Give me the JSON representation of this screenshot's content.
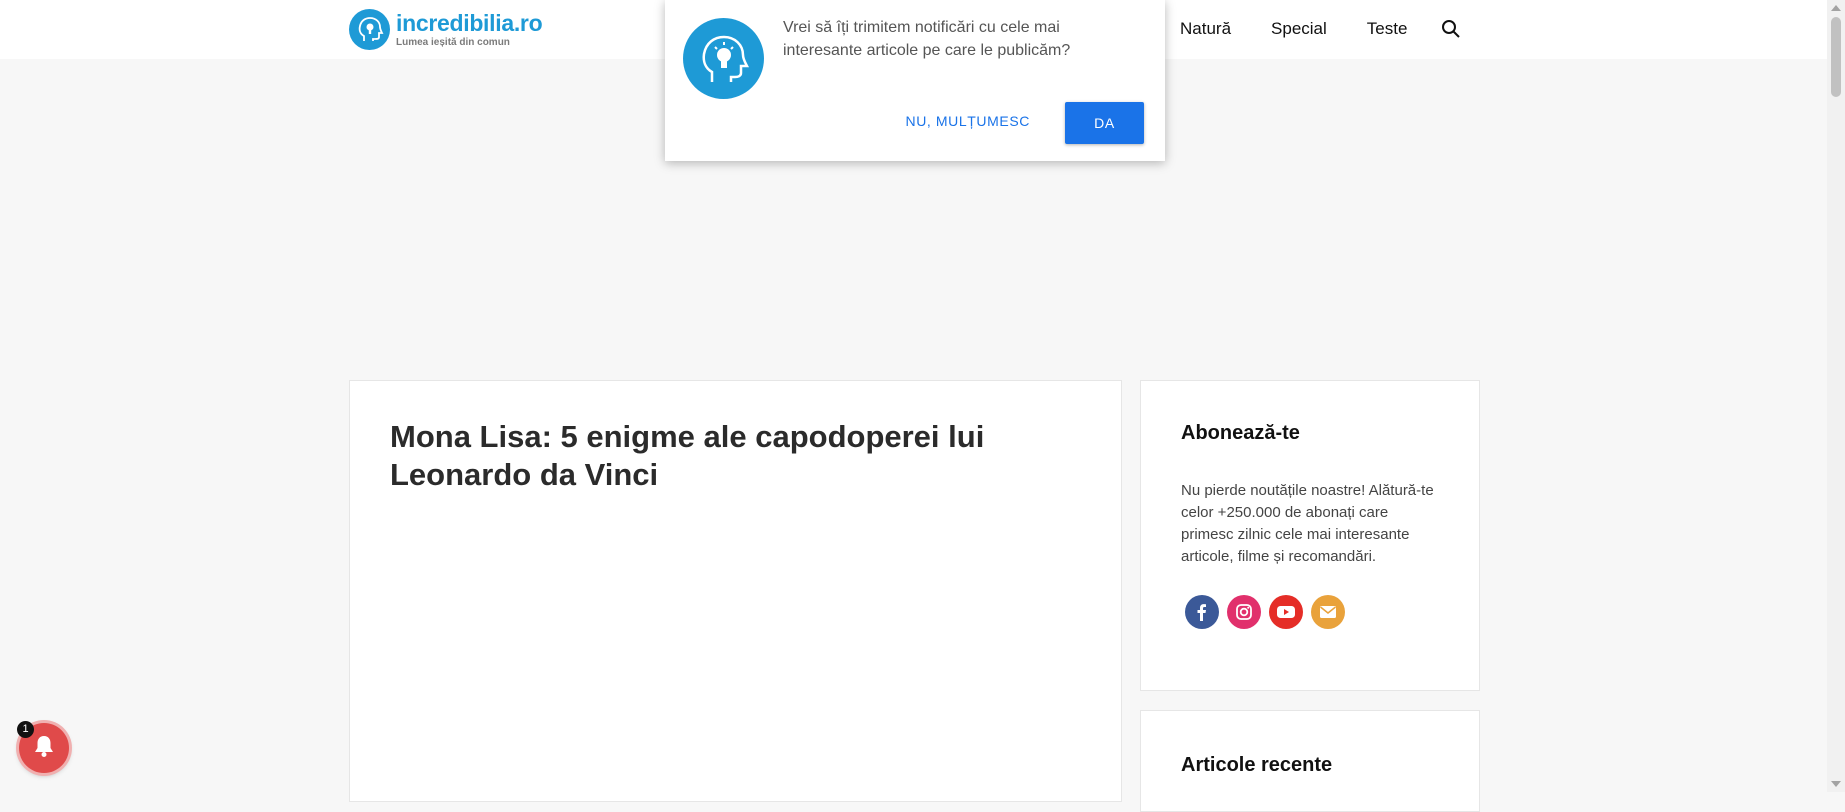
{
  "header": {
    "logo": {
      "name": "incredibilia.ro",
      "tagline": "Lumea ieșită din comun"
    },
    "nav": [
      {
        "label": "Natură"
      },
      {
        "label": "Special"
      },
      {
        "label": "Teste"
      }
    ],
    "search_icon": "search-icon"
  },
  "notification_prompt": {
    "message": "Vrei să îți trimitem notificări cu cele mai interesante articole pe care le publicăm?",
    "decline_label": "NU, MULȚUMESC",
    "accept_label": "DA",
    "icon": "head-lightbulb-icon"
  },
  "article": {
    "title": "Mona Lisa: 5 enigme ale capodoperei lui Leonardo da Vinci"
  },
  "sidebar": {
    "subscribe": {
      "title": "Abonează-te",
      "text": "Nu pierde noutățile noastre! Alătură-te celor +250.000 de abonați care primesc zilnic cele mai interesante articole, filme și recomandări.",
      "socials": [
        {
          "icon": "facebook-icon",
          "color": "#3b5998"
        },
        {
          "icon": "instagram-icon",
          "color": "#e1306c"
        },
        {
          "icon": "youtube-icon",
          "color": "#e52d27"
        },
        {
          "icon": "email-icon",
          "color": "#e9a23b"
        }
      ]
    },
    "recent": {
      "title": "Articole recente"
    }
  },
  "notification_bell": {
    "count": "1",
    "icon": "bell-icon"
  },
  "colors": {
    "brand": "#1e9ad6",
    "button": "#1a73e8",
    "bell": "#e04a4a"
  }
}
